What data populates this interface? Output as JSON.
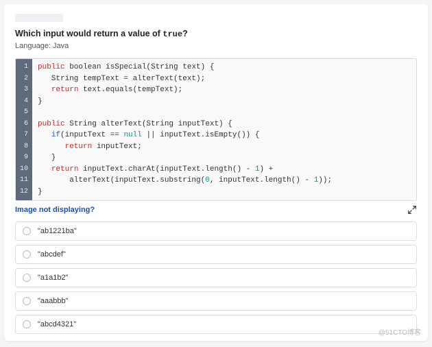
{
  "question": {
    "prefix": "Which input would return a value of ",
    "mono": "true",
    "suffix": "?"
  },
  "language_label": "Language: Java",
  "code": {
    "line_numbers": [
      "1",
      "2",
      "3",
      "4",
      "5",
      "6",
      "7",
      "8",
      "9",
      "10",
      "11",
      "12"
    ],
    "lines": [
      [
        {
          "t": "public",
          "c": "kw-red"
        },
        {
          "t": " boolean isSpecial(String text) {",
          "c": ""
        }
      ],
      [
        {
          "t": "   String tempText = alterText(text);",
          "c": ""
        }
      ],
      [
        {
          "t": "   ",
          "c": ""
        },
        {
          "t": "return",
          "c": "kw-red"
        },
        {
          "t": " text.equals(tempText);",
          "c": ""
        }
      ],
      [
        {
          "t": "}",
          "c": ""
        }
      ],
      [
        {
          "t": "",
          "c": ""
        }
      ],
      [
        {
          "t": "public",
          "c": "kw-red"
        },
        {
          "t": " String alterText(String inputText) {",
          "c": ""
        }
      ],
      [
        {
          "t": "   ",
          "c": ""
        },
        {
          "t": "if",
          "c": "kw-blue"
        },
        {
          "t": "(inputText == ",
          "c": ""
        },
        {
          "t": "null",
          "c": "kw-teal"
        },
        {
          "t": " || inputText.isEmpty()) {",
          "c": ""
        }
      ],
      [
        {
          "t": "      ",
          "c": ""
        },
        {
          "t": "return",
          "c": "kw-red"
        },
        {
          "t": " inputText;",
          "c": ""
        }
      ],
      [
        {
          "t": "   }",
          "c": ""
        }
      ],
      [
        {
          "t": "   ",
          "c": ""
        },
        {
          "t": "return",
          "c": "kw-red"
        },
        {
          "t": " inputText.charAt(inputText.length() - ",
          "c": ""
        },
        {
          "t": "1",
          "c": "kw-teal"
        },
        {
          "t": ") +",
          "c": ""
        }
      ],
      [
        {
          "t": "       alterText(inputText.substring(",
          "c": ""
        },
        {
          "t": "0",
          "c": "kw-teal"
        },
        {
          "t": ", inputText.length() - ",
          "c": ""
        },
        {
          "t": "1",
          "c": "kw-teal"
        },
        {
          "t": "));",
          "c": ""
        }
      ],
      [
        {
          "t": "}",
          "c": ""
        }
      ]
    ]
  },
  "image_not_displaying": "Image not displaying?",
  "options": [
    "\"ab1221ba\"",
    "\"abcdef\"",
    "\"a1a1b2\"",
    "\"aaabbb\"",
    "\"abcd4321\""
  ],
  "watermark": "@51CTO博客"
}
